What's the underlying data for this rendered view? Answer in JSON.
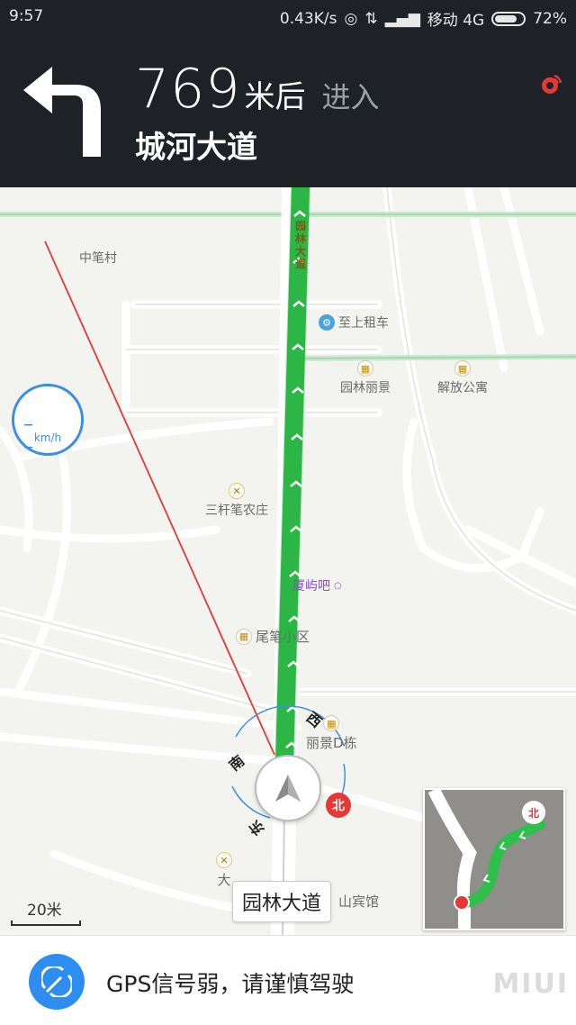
{
  "status_bar": {
    "time": "9:57",
    "net_speed": "0.43K/s",
    "carrier": "移动 4G",
    "battery": "72%"
  },
  "nav": {
    "distance_value": "769",
    "distance_unit": "米后",
    "action": "进入",
    "road": "城河大道",
    "turn_icon": "turn-left-icon"
  },
  "map": {
    "speed_value": "– –",
    "speed_unit": "km/h",
    "road_vertical_label": "园林大道",
    "current_road": "园林大道",
    "scale": "20米",
    "route_color": "#2fbf4b",
    "poi": [
      {
        "name": "中笔村"
      },
      {
        "name": "至上租车"
      },
      {
        "name": "园林丽景"
      },
      {
        "name": "解放公寓"
      },
      {
        "name": "三杆笔农庄"
      },
      {
        "name": "厦屿吧"
      },
      {
        "name": "尾笔小区"
      },
      {
        "name": "丽景D栋"
      },
      {
        "name": "大"
      },
      {
        "name": "山宾馆"
      }
    ],
    "compass": {
      "south": "南",
      "west": "西",
      "east": "东",
      "north": "北"
    },
    "minimap_north": "北"
  },
  "bottom": {
    "gps_message": "GPS信号弱，请谨慎驾驶",
    "watermark": "MIUI"
  }
}
